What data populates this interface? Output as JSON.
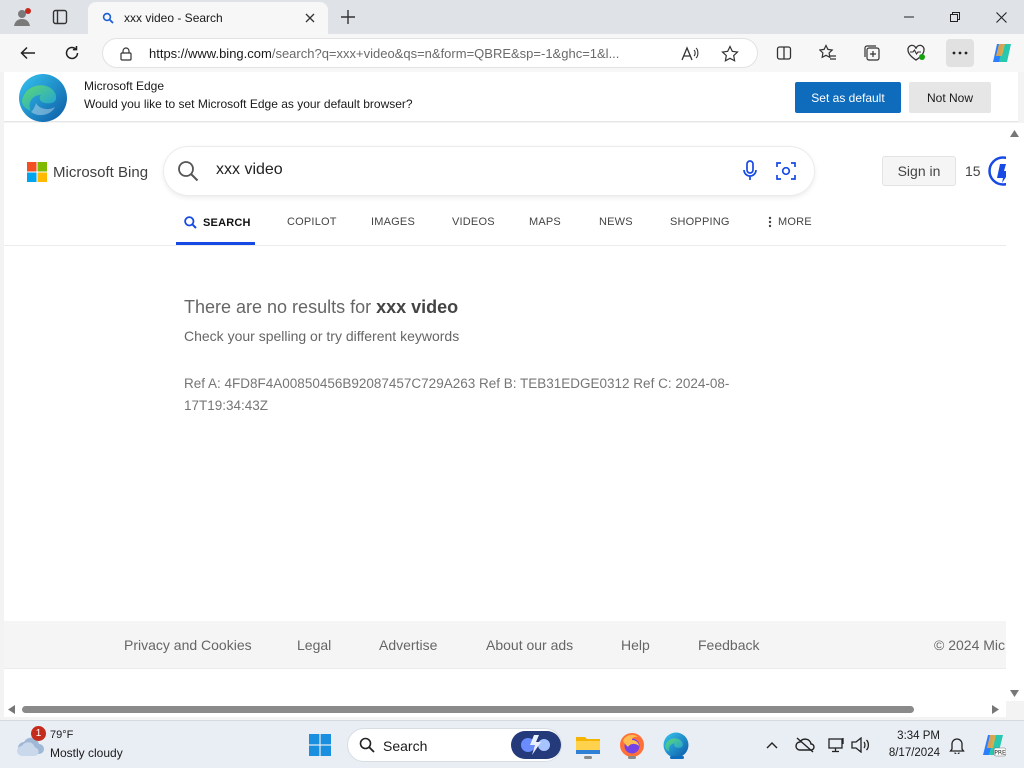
{
  "browser": {
    "tab_title": "xxx video - Search",
    "url_host": "https://www.bing.com",
    "url_path": "/search?q=xxx+video&qs=n&form=QBRE&sp=-1&ghc=1&l..."
  },
  "infobar": {
    "title": "Microsoft Edge",
    "message": "Would you like to set Microsoft Edge as your default browser?",
    "primary_button": "Set as default",
    "secondary_button": "Not Now"
  },
  "bing": {
    "logo_text": "Microsoft Bing",
    "query": "xxx video",
    "sign_in": "Sign in",
    "rewards_count": "15",
    "scopes": [
      {
        "label": "SEARCH",
        "active": true
      },
      {
        "label": "COPILOT",
        "active": false
      },
      {
        "label": "IMAGES",
        "active": false
      },
      {
        "label": "VIDEOS",
        "active": false
      },
      {
        "label": "MAPS",
        "active": false
      },
      {
        "label": "NEWS",
        "active": false
      },
      {
        "label": "SHOPPING",
        "active": false
      },
      {
        "label": "MORE",
        "active": false
      }
    ],
    "no_results_prefix": "There are no results for ",
    "no_results_query": "xxx video",
    "hint": "Check your spelling or try different keywords",
    "reference": "Ref A: 4FD8F4A00850456B92087457C729A263 Ref B: TEB31EDGE0312 Ref C: 2024-08-17T19:34:43Z",
    "footer_links": [
      "Privacy and Cookies",
      "Legal",
      "Advertise",
      "About our ads",
      "Help",
      "Feedback"
    ],
    "copyright": "© 2024 Mic"
  },
  "taskbar": {
    "weather_badge": "1",
    "temperature": "79°F",
    "condition": "Mostly cloudy",
    "search_label": "Search",
    "time": "3:34 PM",
    "date": "8/17/2024"
  },
  "colors": {
    "edge_blue": "#0f6cbd",
    "bing_active_scope": "#174ae4",
    "taskbar_bg": "#e9eef5"
  }
}
